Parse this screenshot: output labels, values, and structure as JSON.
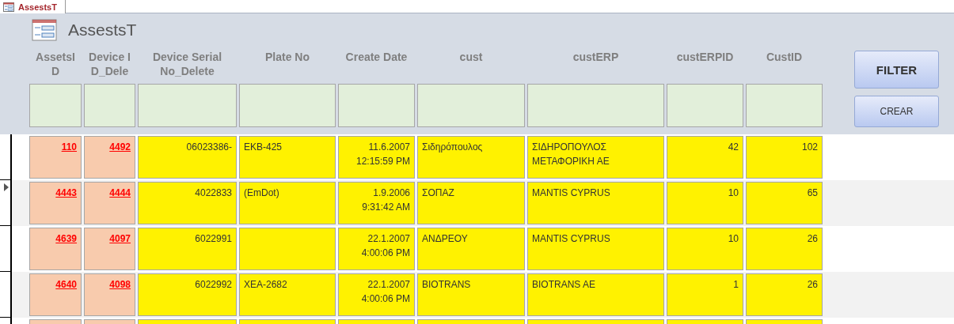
{
  "tab": {
    "label": "AssestsT",
    "selected": true
  },
  "form_title": "AssestsT",
  "columns": [
    {
      "label": "AssetsID",
      "kind": "link"
    },
    {
      "label": "Device ID_Dele",
      "kind": "link"
    },
    {
      "label": "Device Serial No_Delete",
      "kind": "number"
    },
    {
      "label": "Plate No",
      "kind": "text"
    },
    {
      "label": "Create Date",
      "kind": "number"
    },
    {
      "label": "cust",
      "kind": "text"
    },
    {
      "label": "custERP",
      "kind": "text"
    },
    {
      "label": "custERPID",
      "kind": "number"
    },
    {
      "label": "CustID",
      "kind": "number"
    }
  ],
  "buttons": [
    "FILTER",
    "CREAR"
  ],
  "rows": [
    {
      "selected": false,
      "cells": [
        "110",
        "4492",
        "06023386-",
        "EKB-425",
        "11.6.2007 12:15:59 PM",
        "Σιδηρόπουλος",
        "ΣΙΔΗΡΟΠΟΥΛΟΣ ΜΕΤΑΦΟΡΙΚΗ ΑΕ",
        "42",
        "102"
      ]
    },
    {
      "selected": true,
      "cells": [
        "4443",
        "4444",
        "4022833",
        "(EmDot)",
        "1.9.2006 9:31:42 AM",
        "ΣΟΠΑΖ",
        "MANTIS CYPRUS",
        "10",
        "65"
      ]
    },
    {
      "selected": false,
      "cells": [
        "4639",
        "4097",
        "6022991",
        "",
        "22.1.2007 4:00:06 PM",
        "ΑΝΔΡΕΟΥ",
        "MANTIS CYPRUS",
        "10",
        "26"
      ]
    },
    {
      "selected": false,
      "cells": [
        "4640",
        "4098",
        "6022992",
        "XEA-2682",
        "22.1.2007 4:00:06 PM",
        "BIOTRANS",
        "BIOTRANS AE",
        "1",
        "26"
      ]
    },
    {
      "selected": false,
      "cells": [
        "",
        "",
        "",
        "",
        "",
        "",
        "",
        "",
        ""
      ]
    }
  ]
}
